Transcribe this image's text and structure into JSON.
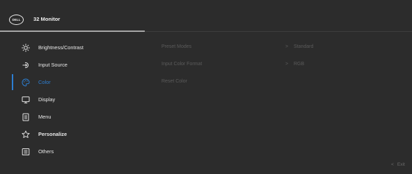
{
  "header": {
    "logo_text": "DELL",
    "title": "32 Monitor"
  },
  "menu": {
    "items": [
      {
        "label": "Brightness/Contrast",
        "icon": "brightness-icon",
        "active": false
      },
      {
        "label": "Input Source",
        "icon": "input-source-icon",
        "active": false
      },
      {
        "label": "Color",
        "icon": "palette-icon",
        "active": true
      },
      {
        "label": "Display",
        "icon": "monitor-icon",
        "active": false
      },
      {
        "label": "Menu",
        "icon": "menu-doc-icon",
        "active": false
      },
      {
        "label": "Personalize",
        "icon": "star-icon",
        "active": false
      },
      {
        "label": "Others",
        "icon": "others-icon",
        "active": false
      }
    ]
  },
  "submenu": {
    "rows": [
      {
        "label": "Preset Modes",
        "chevron": ">",
        "value": "Standard"
      },
      {
        "label": "Input Color Format",
        "chevron": ">",
        "value": "RGB"
      },
      {
        "label": "Reset Color",
        "chevron": "",
        "value": ""
      }
    ]
  },
  "footer": {
    "exit_chevron": "<",
    "exit_label": "Exit"
  },
  "colors": {
    "accent": "#2d7fd3",
    "background": "#2c2c2c",
    "text": "#e8e8e8",
    "disabled_text": "#5b5b5b"
  }
}
